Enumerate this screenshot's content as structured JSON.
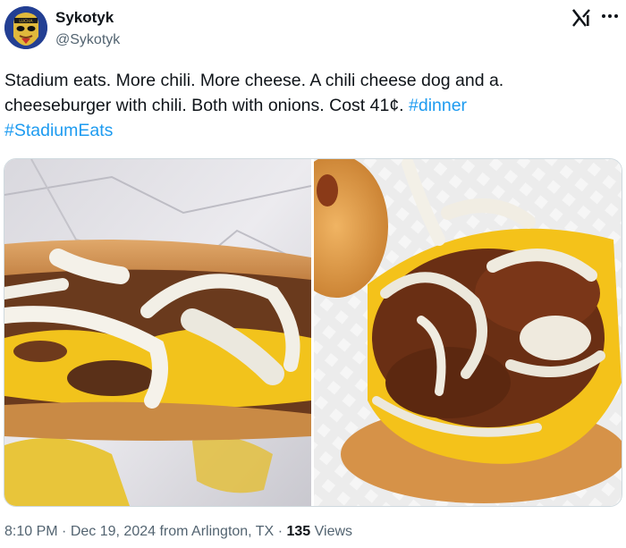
{
  "author": {
    "name": "Sykotyk",
    "handle": "@Sykotyk",
    "avatar_icon": "avatar-mask-icon"
  },
  "header": {
    "logo_icon": "x-logo-icon",
    "more_icon": "more-options-icon"
  },
  "tweet": {
    "text": "Stadium eats. More chili. More cheese. A chili cheese dog and a. cheeseburger with chili. Both with onions. Cost 41¢.",
    "hashtags": [
      "#dinner",
      "#StadiumEats"
    ]
  },
  "media": [
    {
      "kind": "photo",
      "subject": "chili-cheese-dog"
    },
    {
      "kind": "photo",
      "subject": "chili-cheeseburger"
    }
  ],
  "meta": {
    "time": "8:10 PM",
    "date": "Dec 19, 2024",
    "location_prefix": "from",
    "location": "Arlington, TX",
    "separator": "·",
    "views_count": "135",
    "views_label": "Views"
  },
  "colors": {
    "link": "#1d9bf0",
    "text": "#0f1419",
    "secondary": "#536471",
    "border": "#cfd9de"
  }
}
